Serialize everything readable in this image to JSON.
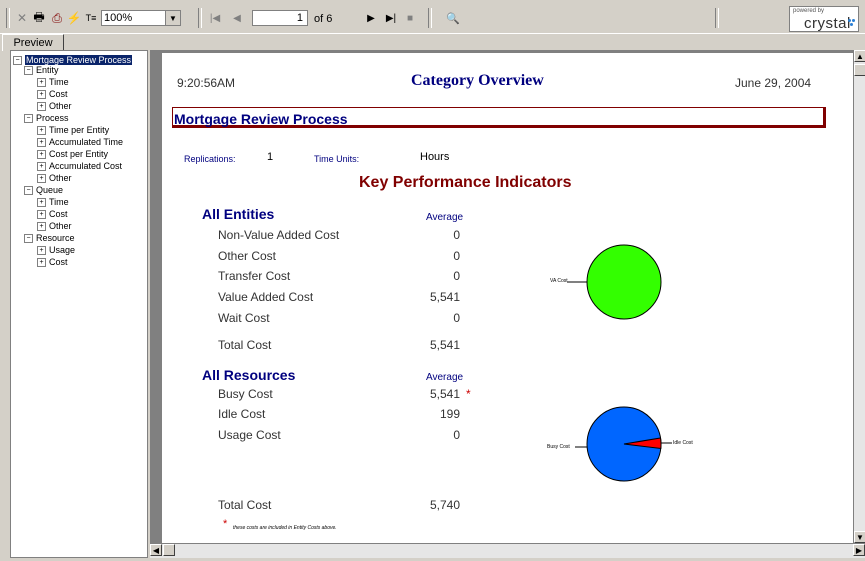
{
  "toolbar": {
    "close_label": "✕",
    "print_label": "🖶",
    "export_label": "⎙",
    "refresh_label": "⚡",
    "tree_toggle_label": "T≡",
    "zoom_value": "100%",
    "page_current": "1",
    "page_of": "of 6",
    "search_label": "🔍",
    "brand_powered": "powered by",
    "brand_name": "crystal"
  },
  "tabs": {
    "preview": "Preview"
  },
  "tree": {
    "root": "Mortgage Review Process",
    "groups": [
      {
        "label": "Entity",
        "items": [
          "Time",
          "Cost",
          "Other"
        ]
      },
      {
        "label": "Process",
        "items": [
          "Time per Entity",
          "Accumulated Time",
          "Cost per Entity",
          "Accumulated Cost",
          "Other"
        ]
      },
      {
        "label": "Queue",
        "items": [
          "Time",
          "Cost",
          "Other"
        ]
      },
      {
        "label": "Resource",
        "items": [
          "Usage",
          "Cost"
        ]
      }
    ]
  },
  "report": {
    "time": "9:20:56AM",
    "title": "Category Overview",
    "date": "June 29, 2004",
    "process_title": "Mortgage Review Process",
    "replications_label": "Replications:",
    "replications_value": "1",
    "time_units_label": "Time Units:",
    "time_units_value": "Hours",
    "kpi_title": "Key Performance Indicators",
    "entities": {
      "title": "All Entities",
      "col_header": "Average",
      "rows": [
        {
          "label": "Non-Value Added Cost",
          "value": "0"
        },
        {
          "label": "Other Cost",
          "value": "0"
        },
        {
          "label": "Transfer Cost",
          "value": "0"
        },
        {
          "label": "Value Added Cost",
          "value": "5,541"
        },
        {
          "label": "Wait Cost",
          "value": "0"
        }
      ],
      "total_label": "Total Cost",
      "total_value": "5,541",
      "pie_label": "VA Cost"
    },
    "resources": {
      "title": "All Resources",
      "col_header": "Average",
      "rows": [
        {
          "label": "Busy Cost",
          "value": "5,541",
          "mark": "*"
        },
        {
          "label": "Idle Cost",
          "value": "199",
          "mark": ""
        },
        {
          "label": "Usage Cost",
          "value": "0",
          "mark": ""
        }
      ],
      "total_label": "Total Cost",
      "total_value": "5,740",
      "pie_label_left": "Busy Cost",
      "pie_label_right": "Idle Cost"
    },
    "footnote_mark": "*",
    "footnote": "these costs are included in Entity Costs above."
  },
  "colors": {
    "title_navy": "#00007f",
    "kpi_maroon": "#800000",
    "pie_green": "#33ff00",
    "pie_blue": "#0066ff",
    "pie_red": "#ff0000"
  }
}
